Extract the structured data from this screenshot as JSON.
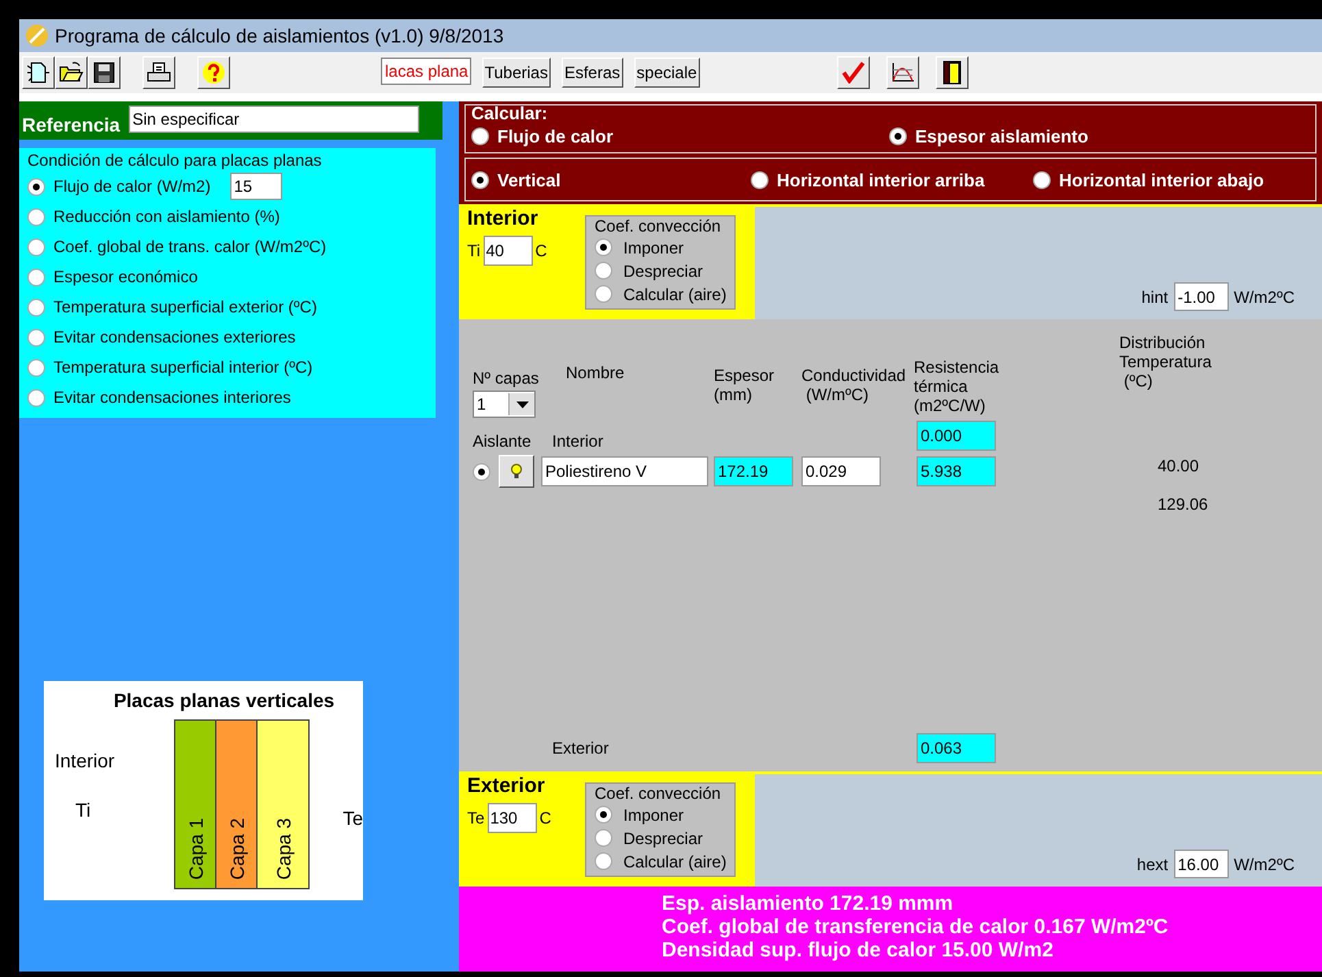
{
  "window": {
    "title": "Programa de cálculo de aislamientos (v1.0) 9/8/2013"
  },
  "toolbar": {
    "file_buttons": [
      {
        "kind": "new"
      },
      {
        "kind": "open"
      },
      {
        "kind": "save"
      }
    ],
    "other_buttons": [
      {
        "kind": "print"
      },
      {
        "kind": "help"
      }
    ],
    "modules": [
      {
        "label": "lacas plana",
        "selected": true
      },
      {
        "label": "Tuberias",
        "selected": false
      },
      {
        "label": "Esferas",
        "selected": false
      },
      {
        "label": "speciale",
        "selected": false
      }
    ],
    "actions": [
      {
        "kind": "check"
      },
      {
        "kind": "chart"
      },
      {
        "kind": "exit"
      }
    ]
  },
  "reference": {
    "label": "Referencia",
    "value": "Sin especificar"
  },
  "condition": {
    "title": "Condición de cálculo para placas planas",
    "options": [
      {
        "label": "Flujo de calor  (W/m2)",
        "selected": true,
        "value": "15"
      },
      {
        "label": "Reducción con aislamiento (%)",
        "selected": false
      },
      {
        "label": "Coef. global de trans. calor (W/m2ºC)",
        "selected": false
      },
      {
        "label": "Espesor económico",
        "selected": false
      },
      {
        "label": "Temperatura superficial exterior (ºC)",
        "selected": false
      },
      {
        "label": "Evitar condensaciones exteriores",
        "selected": false
      },
      {
        "label": "Temperatura superficial interior (ºC)",
        "selected": false
      },
      {
        "label": "Evitar condensaciones interiores",
        "selected": false
      }
    ]
  },
  "diagram": {
    "title": "Placas planas verticales",
    "side_label": "Interior",
    "ti_label": "Ti",
    "te_label": "Te",
    "layers": [
      {
        "label": "Capa 1",
        "color": "#99cc00"
      },
      {
        "label": "Capa 2",
        "color": "#ff9933"
      },
      {
        "label": "Capa 3",
        "color": "#ffff66"
      }
    ]
  },
  "calculate": {
    "title": "Calcular:",
    "targets": [
      {
        "label": "Flujo de calor",
        "selected": false
      },
      {
        "label": "Espesor aislamiento",
        "selected": true
      }
    ],
    "orientations": [
      {
        "label": "Vertical",
        "selected": true
      },
      {
        "label": "Horizontal interior arriba",
        "selected": false
      },
      {
        "label": "Horizontal interior abajo",
        "selected": false
      }
    ]
  },
  "interior": {
    "title": "Interior",
    "temp_label": "Ti",
    "temp": "40",
    "unit": "C",
    "convection_title": "Coef. convección",
    "convection": [
      {
        "label": "Imponer",
        "selected": true
      },
      {
        "label": "Despreciar",
        "selected": false
      },
      {
        "label": "Calcular (aire)",
        "selected": false
      }
    ],
    "h_label": "hint",
    "h_value": "-1.00",
    "h_unit": "W/m2ºC"
  },
  "layers": {
    "count_label": "Nº capas",
    "count": "1",
    "headers": [
      "Nombre",
      "Espesor\n(mm)",
      "Conductividad\n (W/mºC)",
      "Resistencia\ntérmica\n(m2ºC/W)",
      "Distribución\nTemperatura\n (ºC)"
    ],
    "insulation_label": "Aislante",
    "interior_label": "Interior",
    "interior_resistance": "0.000",
    "interior_temp": "40.00",
    "rows": [
      {
        "selected": true,
        "name": "Poliestireno V",
        "thickness": "172.19",
        "conductivity": "0.029",
        "resistance": "5.938",
        "temp": "129.06"
      }
    ],
    "exterior_label": "Exterior",
    "exterior_resistance": "0.063"
  },
  "exterior": {
    "title": "Exterior",
    "temp_label": "Te",
    "temp": "130",
    "unit": "C",
    "convection_title": "Coef. convección",
    "convection": [
      {
        "label": "Imponer",
        "selected": true
      },
      {
        "label": "Despreciar",
        "selected": false
      },
      {
        "label": "Calcular (aire)",
        "selected": false
      }
    ],
    "h_label": "hext",
    "h_value": "16.00",
    "h_unit": "W/m2ºC"
  },
  "results": [
    "Esp. aislamiento 172.19 mmm",
    "Coef. global de transferencia de calor 0.167 W/m2ºC",
    "Densidad sup. flujo de calor 15.00 W/m2"
  ]
}
